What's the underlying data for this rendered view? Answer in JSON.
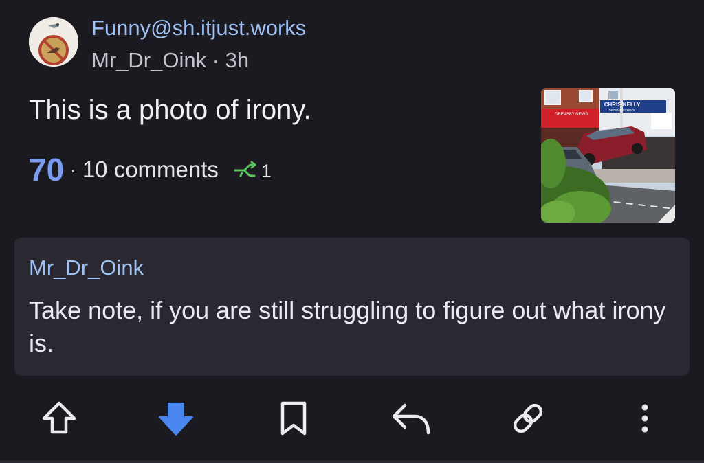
{
  "post": {
    "community": "Funny@sh.itjust.works",
    "author": "Mr_Dr_Oink",
    "separator": " · ",
    "age": "3h",
    "title": "This is a photo of irony.",
    "score": "70",
    "comments": "10 comments",
    "crossposts": "1",
    "thumbnail_sign_left": "GREASBY NEWS",
    "thumbnail_sign_right": "CHRIS KELLY",
    "thumbnail_sign_right_sub": "DRIVING SCHOOL"
  },
  "body": {
    "author": "Mr_Dr_Oink",
    "text": "Take note, if you are still struggling to figure out what irony is."
  },
  "actions": {
    "upvote_icon": "arrow-up-outline-icon",
    "downvote_icon": "arrow-down-filled-icon",
    "save_icon": "bookmark-icon",
    "reply_icon": "reply-icon",
    "link_icon": "link-icon",
    "more_icon": "more-vertical-icon"
  },
  "colors": {
    "background": "#1b1a21",
    "card": "#2a2931",
    "accent": "#7b9cf0",
    "link_text": "#9fc1f4",
    "crosspost": "#5cc65c"
  }
}
